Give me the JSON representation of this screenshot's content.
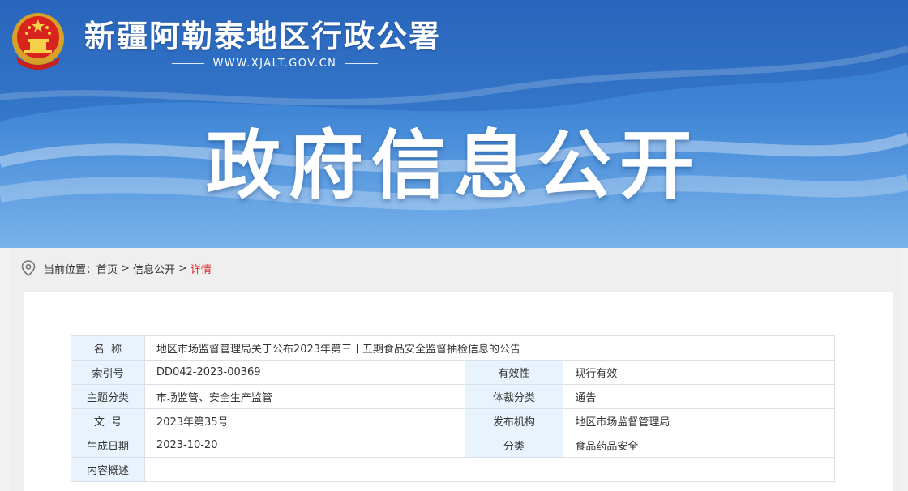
{
  "header": {
    "site_title": "新疆阿勒泰地区行政公署",
    "site_url": "WWW.XJALT.GOV.CN",
    "hero_title": "政府信息公开"
  },
  "breadcrumb": {
    "prefix": "当前位置：",
    "items": [
      "首页",
      "信息公开"
    ],
    "separator": ">",
    "current": "详情"
  },
  "info_table": {
    "name_label": "名  称",
    "name_value": "地区市场监督管理局关于公布2023年第三十五期食品安全监督抽检信息的公告",
    "index_label": "索引号",
    "index_value": "DD042-2023-00369",
    "validity_label": "有效性",
    "validity_value": "现行有效",
    "topic_label": "主题分类",
    "topic_value": "市场监管、安全生产监管",
    "genre_label": "体裁分类",
    "genre_value": "通告",
    "docno_label": "文  号",
    "docno_value": "2023年第35号",
    "issuer_label": "发布机构",
    "issuer_value": "地区市场监督管理局",
    "date_label": "生成日期",
    "date_value": "2023-10-20",
    "category_label": "分类",
    "category_value": "食品药品安全",
    "summary_label": "内容概述",
    "summary_value": ""
  },
  "colors": {
    "banner_blue": "#3f86d6",
    "label_bg": "#e9f3fd",
    "current_red": "#e02a2a"
  }
}
